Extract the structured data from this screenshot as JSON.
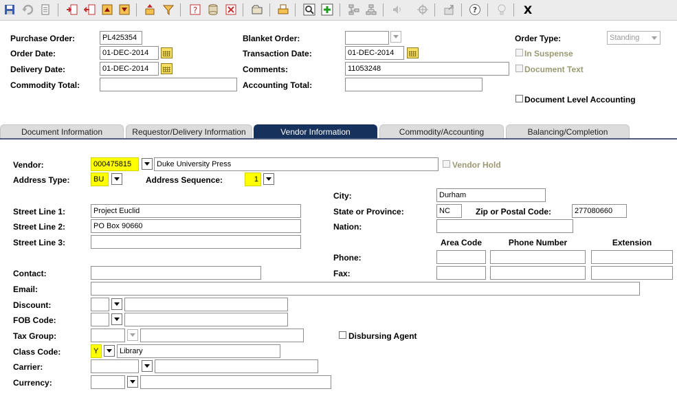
{
  "toolbar": {
    "icons": [
      "save-icon",
      "rollback-icon",
      "print-icon",
      "insert-record-icon",
      "remove-record-icon",
      "previous-block-icon",
      "next-block-icon",
      "options-icon",
      "filter-icon",
      "help-icon",
      "database-icon",
      "cancel-query-icon",
      "folder-icon",
      "print-doc-icon",
      "search-icon",
      "insert-icon",
      "tree-icon",
      "hierarchy-icon",
      "sound-icon",
      "crosshair-icon",
      "export-icon",
      "online-help-icon",
      "lightbulb-icon",
      "exit-icon"
    ],
    "exit_label": "X"
  },
  "header": {
    "purchase_order_label": "Purchase Order:",
    "purchase_order_value": "PL425354",
    "order_date_label": "Order Date:",
    "order_date_value": "01-DEC-2014",
    "delivery_date_label": "Delivery Date:",
    "delivery_date_value": "01-DEC-2014",
    "commodity_total_label": "Commodity Total:",
    "commodity_total_value": "",
    "blanket_order_label": "Blanket Order:",
    "blanket_order_value": "",
    "transaction_date_label": "Transaction Date:",
    "transaction_date_value": "01-DEC-2014",
    "comments_label": "Comments:",
    "comments_value": "11053248",
    "accounting_total_label": "Accounting Total:",
    "accounting_total_value": "",
    "order_type_label": "Order Type:",
    "order_type_value": "Standing",
    "in_suspense_label": "In Suspense",
    "document_text_label": "Document Text",
    "document_level_accounting_label": "Document Level Accounting"
  },
  "tabs": [
    {
      "label": "Document Information"
    },
    {
      "label": "Requestor/Delivery Information"
    },
    {
      "label": "Vendor Information"
    },
    {
      "label": "Commodity/Accounting"
    },
    {
      "label": "Balancing/Completion"
    }
  ],
  "vendor": {
    "vendor_label": "Vendor:",
    "vendor_id": "000475815",
    "vendor_name": "Duke University Press",
    "vendor_hold_label": "Vendor Hold",
    "address_type_label": "Address Type:",
    "address_type_value": "BU",
    "address_sequence_label": "Address Sequence:",
    "address_sequence_value": "1",
    "street1_label": "Street Line 1:",
    "street1_value": "Project Euclid",
    "street2_label": "Street Line 2:",
    "street2_value": "PO Box 90660",
    "street3_label": "Street Line 3:",
    "street3_value": "",
    "city_label": "City:",
    "city_value": "Durham",
    "state_label": "State or Province:",
    "state_value": "NC",
    "zip_label": "Zip or Postal Code:",
    "zip_value": "277080660",
    "nation_label": "Nation:",
    "nation_value": "",
    "area_code_label": "Area Code",
    "phone_number_label": "Phone Number",
    "extension_label": "Extension",
    "phone_label": "Phone:",
    "fax_label": "Fax:",
    "contact_label": "Contact:",
    "contact_value": "",
    "email_label": "Email:",
    "email_value": "",
    "discount_label": "Discount:",
    "fob_code_label": "FOB Code:",
    "tax_group_label": "Tax Group:",
    "disbursing_agent_label": "Disbursing Agent",
    "class_code_label": "Class Code:",
    "class_code_value": "Y",
    "class_code_desc": "Library",
    "carrier_label": "Carrier:",
    "currency_label": "Currency:"
  },
  "colors": {
    "highlight": "#ffff00",
    "active_tab": "#16325c",
    "disabled_label": "#9a9a72"
  }
}
